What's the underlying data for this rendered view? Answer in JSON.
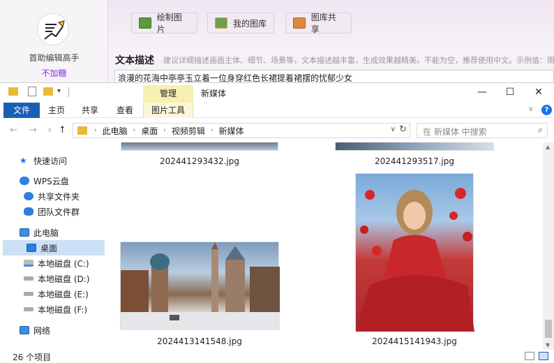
{
  "app": {
    "name": "首助编辑高手",
    "vip_label": "不加糖",
    "buttons": {
      "draw": "绘制图片",
      "gallery": "我的图库",
      "share": "图库共享"
    },
    "desc_label": "文本描述",
    "desc_hint": "建议详细描述画面主体、细节、场景等，文本描述越丰富，生成效果越精美。不能为空，推荐使用中文。示例值：雨",
    "prompt_value": "浪漫的花海中亭亭玉立着一位身穿红色长裙提着裙摆的忧郁少女"
  },
  "explorer": {
    "title": "新媒体",
    "context_tab_head": "管理",
    "ribbon_tabs": {
      "file": "文件",
      "home": "主页",
      "share": "共享",
      "view": "查看",
      "picture_tools": "图片工具"
    },
    "breadcrumb": [
      "此电脑",
      "桌面",
      "视频剪辑",
      "新媒体"
    ],
    "search_placeholder": "在 新媒体 中搜索",
    "nav": {
      "quick_access": "快速访问",
      "wps_cloud": "WPS云盘",
      "shared_files": "共享文件夹",
      "team_files": "团队文件群",
      "this_pc": "此电脑",
      "desktop": "桌面",
      "drive_c": "本地磁盘 (C:)",
      "drive_d": "本地磁盘 (D:)",
      "drive_e": "本地磁盘 (E:)",
      "drive_f": "本地磁盘 (F:)",
      "network": "网络"
    },
    "files": [
      {
        "name": "202441293432.jpg"
      },
      {
        "name": "202441293517.jpg"
      },
      {
        "name": "2024413141548.jpg"
      },
      {
        "name": "2024415141943.jpg"
      }
    ],
    "status": "26 个项目"
  },
  "colors": {
    "accent": "#1a5fb4",
    "context_tab": "#f6efb0",
    "selection": "#cce0f5"
  }
}
